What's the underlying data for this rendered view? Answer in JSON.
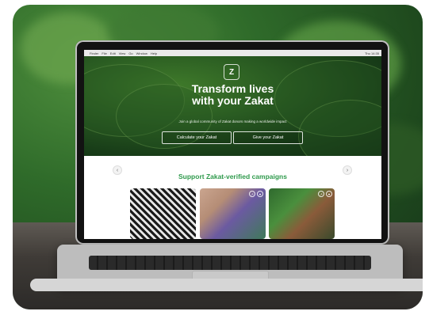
{
  "os_menubar": {
    "items": [
      "Finder",
      "File",
      "Edit",
      "View",
      "Go",
      "Window",
      "Help"
    ],
    "right_items": [
      "Thu 14:35"
    ]
  },
  "hero": {
    "logo_text": "Z",
    "title_line1": "Transform lives",
    "title_line2": "with your Zakat",
    "subtitle": "Join a global community of Zakat donors making a worldwide impact",
    "buttons": {
      "calculate": "Calculate your Zakat",
      "give": "Give your Zakat"
    }
  },
  "campaigns": {
    "heading": "Support Zakat-verified campaigns",
    "nav": {
      "prev": "‹",
      "next": "›"
    },
    "cards": [
      {
        "icons": []
      },
      {
        "icons": [
          "share-icon",
          "heart-icon"
        ]
      },
      {
        "icons": [
          "share-icon",
          "heart-icon"
        ]
      }
    ]
  }
}
